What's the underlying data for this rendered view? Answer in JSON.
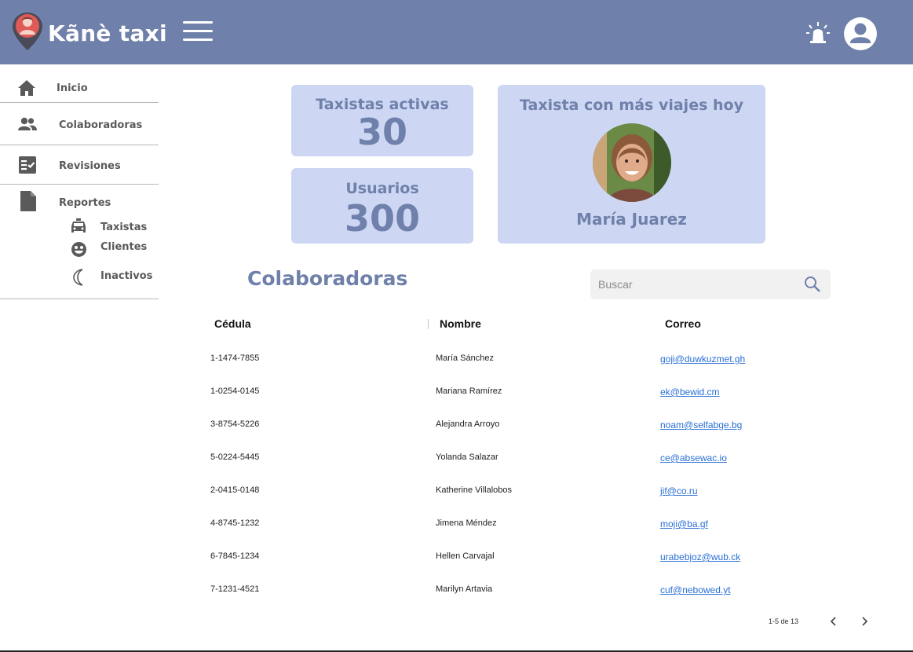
{
  "header": {
    "brand": "Kãnè taxi",
    "color": "#6f80aa"
  },
  "sidebar": {
    "items": [
      {
        "label": "Inicio",
        "icon": "home-icon"
      },
      {
        "label": "Colaboradoras",
        "icon": "people-icon"
      },
      {
        "label": "Revisiones",
        "icon": "checklist-icon"
      },
      {
        "label": "Reportes",
        "icon": "document-icon"
      }
    ],
    "subitems": [
      {
        "label": "Taxistas",
        "icon": "taxi-icon"
      },
      {
        "label": "Clientes",
        "icon": "face-icon"
      },
      {
        "label": "Inactivos",
        "icon": "moon-icon"
      }
    ]
  },
  "stats": {
    "active_title": "Taxistas activas",
    "active_value": "30",
    "users_title": "Usuarios",
    "users_value": "300",
    "top_title": "Taxista con más viajes hoy",
    "top_name": "María Juarez"
  },
  "section": {
    "title": "Colaboradoras"
  },
  "search": {
    "placeholder": "Buscar",
    "value": ""
  },
  "table": {
    "columns": [
      "Cédula",
      "Nombre",
      "Correo"
    ],
    "rows": [
      {
        "cedula": "1-1474-7855",
        "nombre": "María Sánchez",
        "correo": "goji@duwkuzmet.gh"
      },
      {
        "cedula": "1-0254-0145",
        "nombre": "Mariana Ramírez",
        "correo": "ek@bewid.cm"
      },
      {
        "cedula": "3-8754-5226",
        "nombre": "Alejandra Arroyo",
        "correo": "noam@selfabge.bg"
      },
      {
        "cedula": "5-0224-5445",
        "nombre": "Yolanda Salazar",
        "correo": "ce@absewac.io"
      },
      {
        "cedula": "2-0415-0148",
        "nombre": "Katherine Villalobos",
        "correo": "jif@co.ru"
      },
      {
        "cedula": "4-8745-1232",
        "nombre": "Jimena Méndez",
        "correo": "moji@ba.gf"
      },
      {
        "cedula": "6-7845-1234",
        "nombre": "Hellen Carvajal",
        "correo": "urabebjoz@wub.ck"
      },
      {
        "cedula": "7-1231-4521",
        "nombre": "Marilyn Artavia",
        "correo": "cuf@nebowed.yt"
      }
    ]
  },
  "pagination": {
    "text": "1-5 de 13"
  },
  "colors": {
    "accent": "#6f80aa",
    "card": "#cdd7f4",
    "link": "#2a6fd6"
  }
}
